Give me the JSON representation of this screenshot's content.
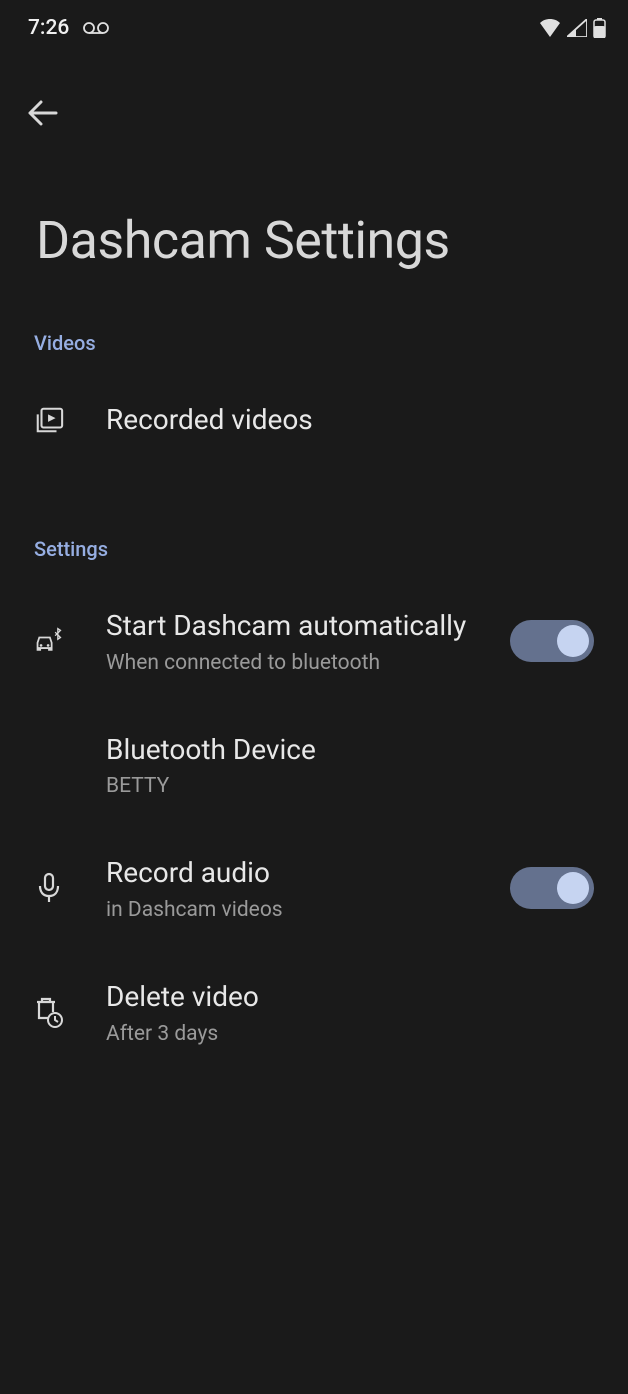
{
  "status_bar": {
    "time": "7:26"
  },
  "page": {
    "title": "Dashcam Settings"
  },
  "sections": {
    "videos": {
      "header": "Videos",
      "recorded": {
        "title": "Recorded videos"
      }
    },
    "settings": {
      "header": "Settings",
      "auto_start": {
        "title": "Start Dashcam automatically",
        "subtitle": "When connected to bluetooth",
        "toggle_on": true
      },
      "bluetooth_device": {
        "title": "Bluetooth Device",
        "subtitle": "BETTY"
      },
      "record_audio": {
        "title": "Record audio",
        "subtitle": "in Dashcam videos",
        "toggle_on": true
      },
      "delete_video": {
        "title": "Delete video",
        "subtitle": "After 3 days"
      }
    }
  }
}
